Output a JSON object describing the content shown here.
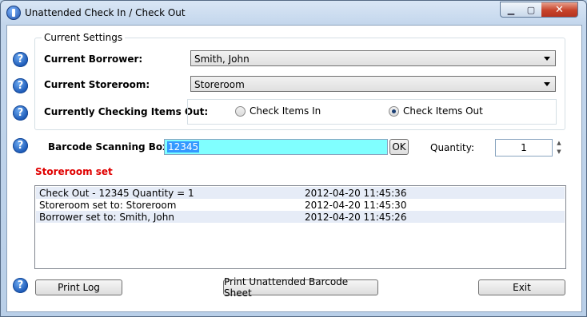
{
  "window": {
    "title": "Unattended Check In / Check Out",
    "minimize": "▁",
    "maximize": "▢",
    "close": "✕"
  },
  "settings": {
    "group_title": "Current Settings",
    "borrower_label": "Current Borrower:",
    "borrower_value": "Smith, John",
    "storeroom_label": "Current Storeroom:",
    "storeroom_value": "Storeroom",
    "mode_label": "Currently Checking Items Out:",
    "radio_in": "Check Items In",
    "radio_out": "Check Items Out",
    "selected_mode": "out"
  },
  "scan": {
    "label": "Barcode Scanning Box:",
    "value": "12345",
    "ok_label": "OK",
    "quantity_label": "Quantity:",
    "quantity_value": "1",
    "spin_up": "▲",
    "spin_down": "▼"
  },
  "status_text": "Storeroom set",
  "help_glyph": "?",
  "log": [
    {
      "message": "Check Out - 12345 Quantity = 1",
      "time": "2012-04-20 11:45:36"
    },
    {
      "message": "Storeroom set to: Storeroom",
      "time": "2012-04-20 11:45:30"
    },
    {
      "message": "Borrower set to: Smith, John",
      "time": "2012-04-20 11:45:26"
    }
  ],
  "buttons": {
    "print_log": "Print Log",
    "print_sheet": "Print Unattended Barcode  Sheet",
    "exit": "Exit"
  },
  "colors": {
    "barcode_bg": "#80ffff",
    "status_red": "#e00000",
    "help_blue": "#1a57b5"
  }
}
